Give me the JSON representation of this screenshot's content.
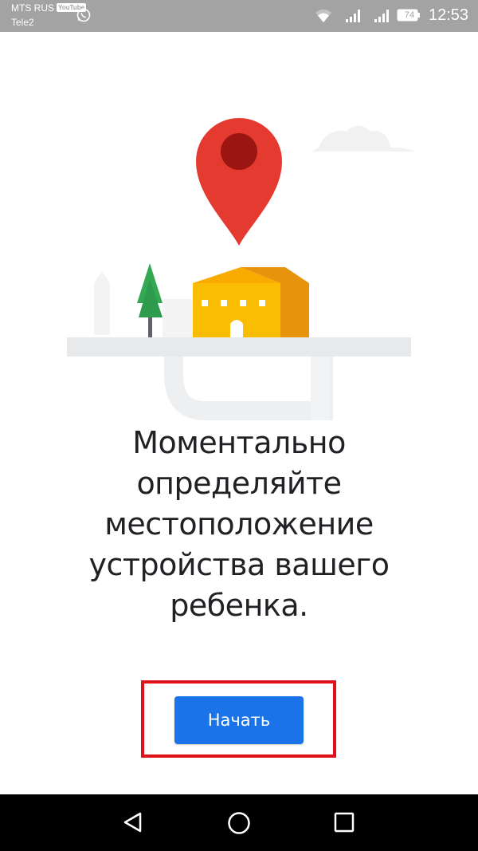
{
  "status_bar": {
    "carrier_primary": "MTS RUS",
    "carrier_secondary": "Tele2",
    "notification_badge": "YouTube",
    "battery_level": "74",
    "time": "12:53",
    "icons": [
      "whatsapp-icon",
      "wifi-icon",
      "signal-icon",
      "signal-icon",
      "battery-icon"
    ]
  },
  "illustration": {
    "icons": [
      "location-pin-icon",
      "house-icon",
      "tree-icon",
      "cloud-icon",
      "road-icon"
    ],
    "colors": {
      "pin": "#e53a2f",
      "pin_dot": "#9b1512",
      "house": "#fbbc04",
      "house_side": "#e8930c",
      "tree": "#34a853",
      "road": "#e8e9eb"
    }
  },
  "main": {
    "headline": "Моментально определяйте местоположение устройства вашего ребенка.",
    "start_button_label": "Начать"
  },
  "colors": {
    "accent": "#1a73e8",
    "highlight": "#e0111b",
    "status_bar": "#a3a3a3"
  },
  "nav_bar": {
    "icons": [
      "back-icon",
      "home-icon",
      "recent-apps-icon"
    ]
  }
}
